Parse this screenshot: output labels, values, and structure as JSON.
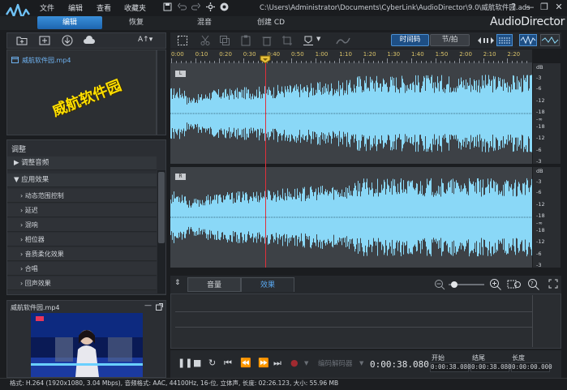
{
  "menu": {
    "file": "文件",
    "edit": "编辑",
    "view": "查看",
    "favorites": "收藏夹"
  },
  "window": {
    "path": "C:\\Users\\Administrator\\Documents\\CyberLink\\AudioDirector\\9.0\\威航软件园.ads",
    "help": "?",
    "minimize": "—",
    "restore": "❐",
    "close": "✕"
  },
  "modes": {
    "edit": "编辑",
    "restore": "恢复",
    "mix": "混音",
    "create_cd": "创建 CD"
  },
  "brand": "AudioDirector",
  "media_toolbar": {
    "font_size": "A↑▾"
  },
  "media_library": {
    "items": [
      "威航软件园.mp4"
    ],
    "watermark": "威航软件园"
  },
  "adjust": {
    "title": "调整",
    "groups": [
      {
        "label": "调整音频",
        "expanded": false
      },
      {
        "label": "应用效果",
        "expanded": true
      }
    ],
    "effects": [
      "动态范围控制",
      "延迟",
      "混响",
      "相位器",
      "音质柔化效果",
      "合唱",
      "回声效果"
    ]
  },
  "preview": {
    "title": "威航软件园.mp4"
  },
  "toolbar": {
    "timecode_label": "时间码",
    "beat_label": "节/拍"
  },
  "ruler": {
    "ticks": [
      "0:00",
      "0:10",
      "0:20",
      "0:30",
      "0:40",
      "0:50",
      "1:00",
      "1:10",
      "1:20",
      "1:30",
      "1:40",
      "1:50",
      "2:00",
      "2:10",
      "2:20"
    ]
  },
  "channels": {
    "left": "L",
    "right": "R"
  },
  "db_scale": [
    "dB",
    "-3",
    "-6",
    "-12",
    "-18",
    "-∞",
    "-18",
    "-12",
    "-6",
    "-3"
  ],
  "bottom_tabs": {
    "volume": "音量",
    "effects": "效果"
  },
  "transport": {
    "codec_label": "编码解码器",
    "timecode": "0:00:38.080",
    "start_label": "开始",
    "end_label": "结尾",
    "length_label": "长度",
    "start": "0:00:38.080",
    "end": "0:00:38.080",
    "length": "0:00:00.000"
  },
  "status": "格式: H.264 (1920x1080, 3.04 Mbps), 音频格式: AAC, 44100Hz, 16-位, 立体声, 长度: 02:26.123, 大小: 55.96 MB",
  "colors": {
    "accent": "#2f86d6",
    "waveform": "#8ad8f7",
    "playhead": "#e0303a",
    "timeline_text": "#d9c36a",
    "watermark": "#ffe000"
  }
}
